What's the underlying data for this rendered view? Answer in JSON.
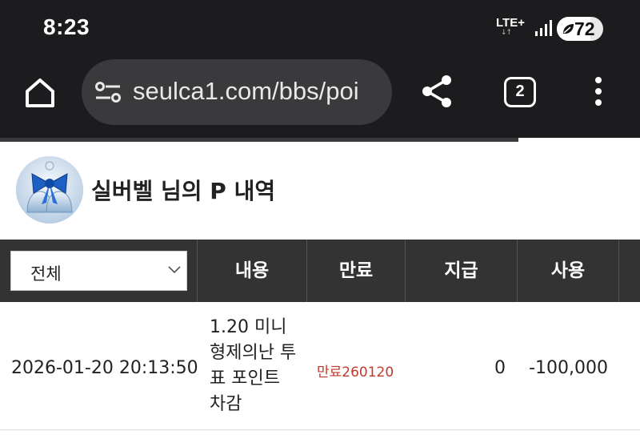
{
  "status_bar": {
    "time": "8:23",
    "network": "LTE+",
    "network_arrows": "↓↑",
    "battery_percent": "72",
    "battery_level": 0.72
  },
  "browser": {
    "url": "seulca1.com/bbs/poi",
    "tab_count": "2",
    "page_load_progress": 0.81
  },
  "header": {
    "title": "실버벨 님의 P 내역"
  },
  "table": {
    "filter": {
      "selected": "전체"
    },
    "columns": [
      "내용",
      "만료",
      "지급",
      "사용"
    ],
    "rows": [
      {
        "datetime": "2026-01-20 20:13:50",
        "content": "1.20 미니 형제의난 투표 포인트 차감",
        "expire": "만료260120",
        "paid": "0",
        "used": "-100,000"
      }
    ]
  },
  "colors": {
    "chrome_bg": "#1c1c1e",
    "url_bar_bg": "#3a3a3c",
    "table_header_bg": "#333333",
    "expire_text": "#c0392b"
  }
}
